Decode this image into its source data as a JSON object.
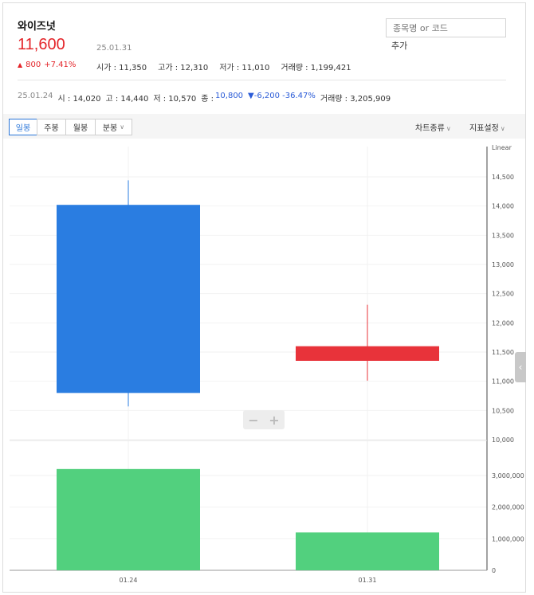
{
  "stock": {
    "name": "와이즈넛",
    "price": "11,600",
    "date": "25.01.31",
    "change_icon": "up-triangle",
    "change_glyph": "▲",
    "change_amount": "800",
    "change_pct": "+7.41%",
    "open": "시가 : 11,350",
    "high": "고가 : 12,310",
    "low": "저가 : 11,010",
    "volume": "거래량 : 1,199,421"
  },
  "search": {
    "placeholder": "종목명 or 코드",
    "add_label": "추가"
  },
  "prev": {
    "date": "25.01.24",
    "open": "시 : 14,020",
    "high": "고 : 14,440",
    "low": "저 : 10,570",
    "close_label": "종 :",
    "close_value": "10,800",
    "change_glyph": "▼",
    "change_value": "-6,200 -36.47%",
    "volume": "거래량 : 3,205,909"
  },
  "toolbar": {
    "tabs": [
      "일봉",
      "주봉",
      "월봉",
      "분봉"
    ],
    "active_tab": "일봉",
    "chart_type_label": "차트종류",
    "indicator_label": "지표설정"
  },
  "colors": {
    "up": "#e8333a",
    "down": "#2a7de1",
    "volume": "#52d07e",
    "accent": "#2a76d9"
  },
  "chart_data": {
    "type": "candlestick",
    "scale_label": "Linear",
    "categories": [
      "01.24",
      "01.31"
    ],
    "ohlc": [
      {
        "x": "01.24",
        "open": 14020,
        "high": 14440,
        "low": 10570,
        "close": 10800
      },
      {
        "x": "01.31",
        "open": 11350,
        "high": 12310,
        "low": 11010,
        "close": 11600
      }
    ],
    "price_ticks": [
      "10,000",
      "10,500",
      "11,000",
      "11,500",
      "12,000",
      "12,500",
      "13,000",
      "13,500",
      "14,000",
      "14,500"
    ],
    "ylim_price": [
      10000,
      14800
    ],
    "volume": [
      3205909,
      1199421
    ],
    "volume_ticks": [
      "0",
      "1,000,000",
      "2,000,000",
      "3,000,000"
    ],
    "ylim_volume": [
      0,
      3600000
    ]
  }
}
